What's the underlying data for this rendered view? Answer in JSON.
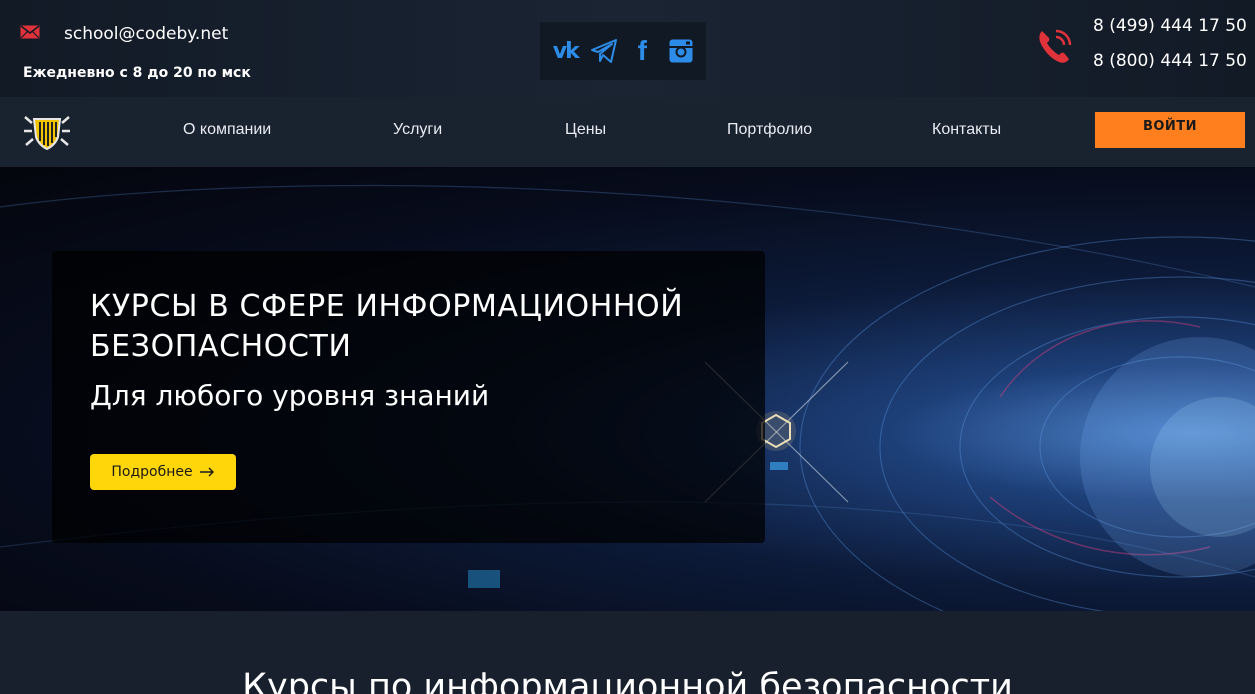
{
  "topbar": {
    "email": "school@codeby.net",
    "hours": "Ежедневно с 8 до 20 по мск",
    "phone1": "8 (499)  444 17 50",
    "phone2": "8 (800) 444 17 50"
  },
  "social": {
    "icons": [
      "vk-icon",
      "telegram-icon",
      "facebook-icon",
      "instagram-icon"
    ],
    "vk_label": "vk",
    "fb_label": "f"
  },
  "nav": {
    "items": [
      {
        "label": "О компании"
      },
      {
        "label": "Услуги"
      },
      {
        "label": "Цены"
      },
      {
        "label": "Портфолио"
      },
      {
        "label": "Контакты"
      }
    ],
    "login": "ВОЙТИ"
  },
  "hero": {
    "title": "КУРСЫ В СФЕРЕ ИНФОРМАЦИОННОЙ БЕЗОПАСНОСТИ",
    "subtitle": "Для любого уровня знаний",
    "button": "Подробнее"
  },
  "section": {
    "title": "Курсы по информационной безопасности"
  },
  "colors": {
    "accent_orange": "#ff7f1f",
    "accent_yellow": "#ffd60a",
    "social_blue": "#2d8ce8",
    "icon_red": "#e0323a"
  }
}
